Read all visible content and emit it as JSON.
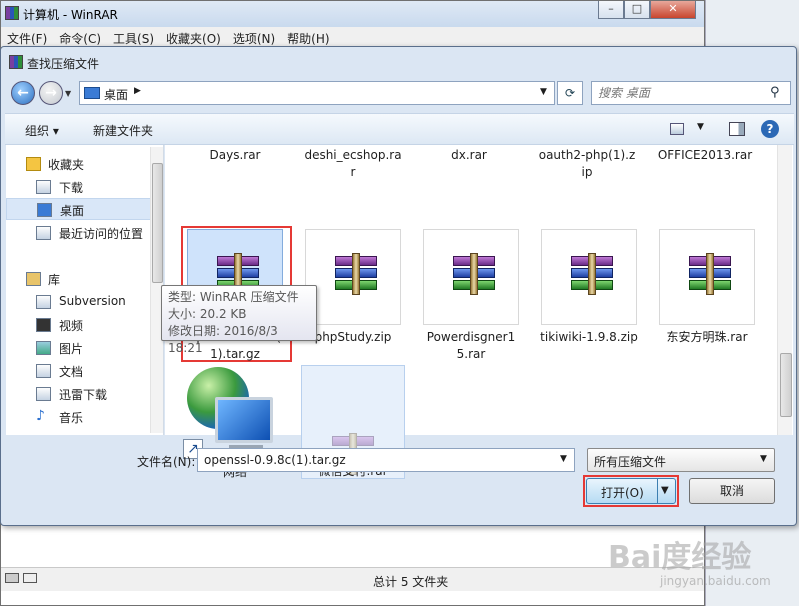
{
  "winrar": {
    "title": "计算机 - WinRAR",
    "menu": [
      "文件(F)",
      "命令(C)",
      "工具(S)",
      "收藏夹(O)",
      "选项(N)",
      "帮助(H)"
    ],
    "status": "总计 5 文件夹"
  },
  "dialog": {
    "title": "查找压缩文件",
    "address": "桌面",
    "search_placeholder": "搜索 桌面",
    "commands": {
      "organize": "组织 ▾",
      "new_folder": "新建文件夹"
    },
    "nav": [
      {
        "label": "收藏夹",
        "icon": "star-icon"
      },
      {
        "label": "下载",
        "icon": "download-folder-icon"
      },
      {
        "label": "桌面",
        "icon": "desktop-icon"
      },
      {
        "label": "最近访问的位置",
        "icon": "recent-places-icon"
      },
      {
        "label": "库",
        "icon": "library-icon"
      },
      {
        "label": "Subversion",
        "icon": "folder-icon"
      },
      {
        "label": "视频",
        "icon": "video-icon"
      },
      {
        "label": "图片",
        "icon": "picture-icon"
      },
      {
        "label": "文档",
        "icon": "document-icon"
      },
      {
        "label": "迅雷下载",
        "icon": "folder-icon"
      },
      {
        "label": "音乐",
        "icon": "music-icon"
      }
    ],
    "top_row": [
      "Days.rar",
      "deshi_ecshop.ra\nr",
      "dx.rar",
      "oauth2-php(1).z\nip",
      "OFFICE2013.rar"
    ],
    "files": [
      {
        "label": "openssl-0.9.8c(\n1).tar.gz"
      },
      {
        "label": "phpStudy.zip"
      },
      {
        "label": "Powerdisgner1\n5.rar"
      },
      {
        "label": "tikiwiki-1.9.8.zip"
      },
      {
        "label": "东安方明珠.rar"
      }
    ],
    "network": "网络",
    "wechat": "微信支付.rar",
    "tooltip": {
      "type": "类型: WinRAR 压缩文件",
      "size": "大小: 20.2 KB",
      "date": "修改日期: 2016/8/3 18:21"
    },
    "filename_label": "文件名(N):",
    "filename_value": "openssl-0.9.8c(1).tar.gz",
    "filetype": "所有压缩文件",
    "open": "打开(O)",
    "cancel": "取消"
  },
  "watermark": {
    "main": "Bai度经验",
    "sub": "jingyan.baidu.com"
  }
}
